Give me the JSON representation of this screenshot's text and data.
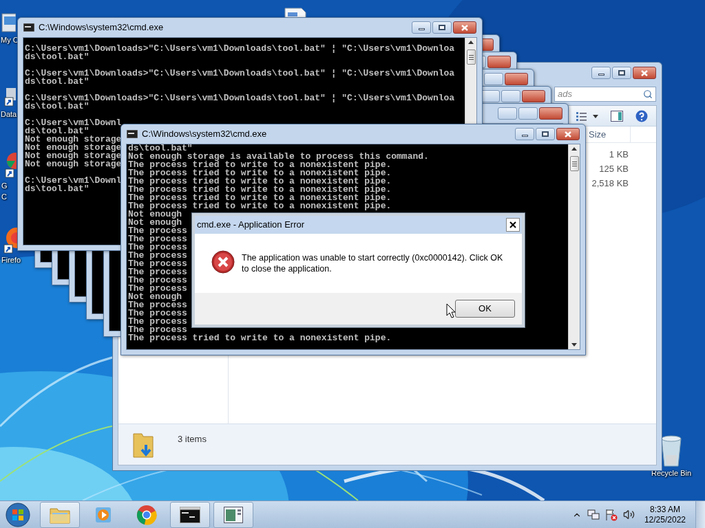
{
  "desktop_icons": [
    {
      "kind": "computer",
      "label": [
        "My C"
      ]
    },
    {
      "kind": "shortcut",
      "label": [
        "Data"
      ]
    },
    {
      "kind": "browser",
      "label": [
        "G",
        "C"
      ]
    },
    {
      "kind": "firefox",
      "label": [
        "Firefo"
      ]
    },
    {
      "kind": "recycle",
      "label": [
        "Recycle Bin"
      ]
    }
  ],
  "explorer": {
    "search_placeholder": "ads",
    "size_header": "Size",
    "sizes": [
      "1 KB",
      "125 KB",
      "2,518 KB"
    ],
    "status": "3 items"
  },
  "background_windows": [
    {
      "kind": "console"
    },
    {
      "kind": "console"
    },
    {
      "kind": "console"
    },
    {
      "kind": "console"
    },
    {
      "kind": "console"
    }
  ],
  "cmd_windows": [
    {
      "title": "C:\\Windows\\system32\\cmd.exe",
      "blocks": [
        [
          "C:\\Users\\vm1\\Downloads>\"C:\\Users\\vm1\\Downloads\\tool.bat\" ¦ \"C:\\Users\\vm1\\Downloa",
          "ds\\tool.bat\""
        ],
        [
          "C:\\Users\\vm1\\Downloads>\"C:\\Users\\vm1\\Downloads\\tool.bat\" ¦ \"C:\\Users\\vm1\\Downloa",
          "ds\\tool.bat\""
        ],
        [
          "C:\\Users\\vm1\\Downloads>\"C:\\Users\\vm1\\Downloads\\tool.bat\" ¦ \"C:\\Users\\vm1\\Downloa",
          "ds\\tool.bat\""
        ],
        [
          "C:\\Users\\vm1\\Downl",
          "ds\\tool.bat\"",
          "Not enough storage",
          "Not enough storage",
          "Not enough storage",
          "Not enough storage"
        ],
        [
          "C:\\Users\\vm1\\Downl",
          "ds\\tool.bat\""
        ]
      ]
    },
    {
      "title": "C:\\Windows\\system32\\cmd.exe",
      "blocks": [
        [
          "ds\\tool.bat\"",
          "Not enough storage is available to process this command.",
          "The process tried to write to a nonexistent pipe.",
          "The process tried to write to a nonexistent pipe.",
          "The process tried to write to a nonexistent pipe.",
          "The process tried to write to a nonexistent pipe.",
          "The process tried to write to a nonexistent pipe.",
          "The process tried to write to a nonexistent pipe.",
          "Not enough",
          "Not enough",
          "The process",
          "The process",
          "The process",
          "The process",
          "The process",
          "The process",
          "The process",
          "The process",
          "Not enough",
          "The process",
          "The process",
          "The process",
          "The process",
          "The process tried to write to a nonexistent pipe."
        ]
      ]
    }
  ],
  "dialog": {
    "title": "cmd.exe - Application Error",
    "message": "The application was unable to start correctly (0xc0000142). Click OK to close the application.",
    "button": "OK"
  },
  "taskbar": {
    "items": [
      {
        "kind": "folder",
        "open": true
      },
      {
        "kind": "media",
        "open": false
      },
      {
        "kind": "browser",
        "open": false
      },
      {
        "kind": "console",
        "open": true
      },
      {
        "kind": "window",
        "open": true
      }
    ],
    "time": "8:33 AM",
    "date": "12/25/2022"
  }
}
